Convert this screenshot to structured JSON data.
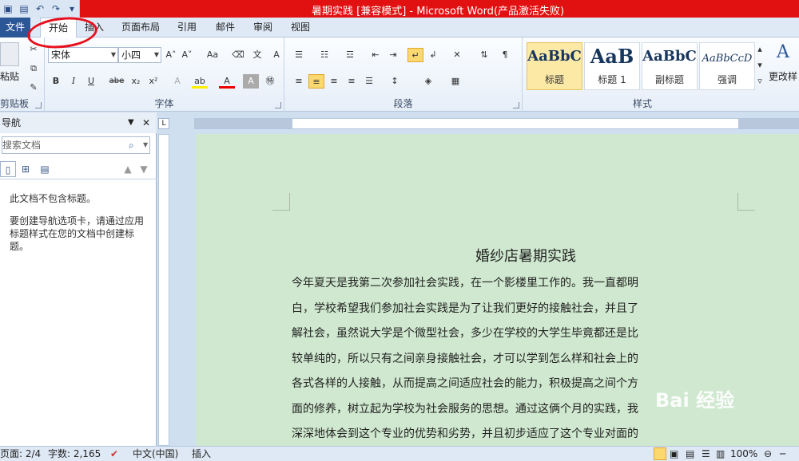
{
  "window": {
    "title": "暑期实践 [兼容模式] - Microsoft Word(产品激活失败)"
  },
  "tabs": [
    {
      "label": "文件"
    },
    {
      "label": "开始"
    },
    {
      "label": "插入"
    },
    {
      "label": "页面布局"
    },
    {
      "label": "引用"
    },
    {
      "label": "邮件"
    },
    {
      "label": "审阅"
    },
    {
      "label": "视图"
    }
  ],
  "ribbon": {
    "clipboard": {
      "paste_label": "粘贴",
      "group_label": "剪贴板"
    },
    "font": {
      "font_name": "宋体",
      "font_size": "小四",
      "group_label": "字体",
      "bold": "B",
      "italic": "I",
      "underline": "U",
      "strike": "abe",
      "subscript": "x₂",
      "superscript": "x²",
      "case": "Aa"
    },
    "paragraph": {
      "group_label": "段落"
    },
    "styles": {
      "group_label": "样式",
      "items": [
        {
          "preview": "AaBbC",
          "name": "标题"
        },
        {
          "preview": "AaB",
          "name": "标题 1"
        },
        {
          "preview": "AaBbC",
          "name": "副标题"
        },
        {
          "preview": "AaBbCcD",
          "name": "强调"
        }
      ],
      "change_styles": "更改样"
    }
  },
  "nav_pane": {
    "title": "导航",
    "search_placeholder": "搜索文档",
    "no_headings": "此文档不包含标题。",
    "hint": "要创建导航选项卡，请通过应用标题样式在您的文档中创建标题。"
  },
  "document": {
    "title": "婚纱店暑期实践",
    "lines": [
      "今年夏天是我第二次参加社会实践，在一个影楼里工作的。我一直都明",
      "白，学校希望我们参加社会实践是为了让我们更好的接触社会，并且了",
      "解社会，虽然说大学是个微型社会，多少在学校的大学生毕竟都还是比",
      "较单纯的，所以只有之间亲身接触社会，才可以学到怎么样和社会上的",
      "各式各样的人接触，从而提高之间适应社会的能力，积极提高之间个方",
      "面的修养，树立起为学校为社会服务的思想。通过这俩个月的实践，我",
      "深深地体会到这个专业的优势和劣势，并且初步适应了这个专业对面的"
    ]
  },
  "status_bar": {
    "page": "页面: 2/4",
    "words": "字数: 2,165",
    "language": "中文(中国)",
    "mode": "插入",
    "zoom": "100%"
  },
  "watermark": "Bai 经验",
  "colors": {
    "title_bar": "#e21111",
    "file_tab": "#2b5796",
    "page_bg": "#cfe8cf",
    "annotation": "#e8101c"
  }
}
